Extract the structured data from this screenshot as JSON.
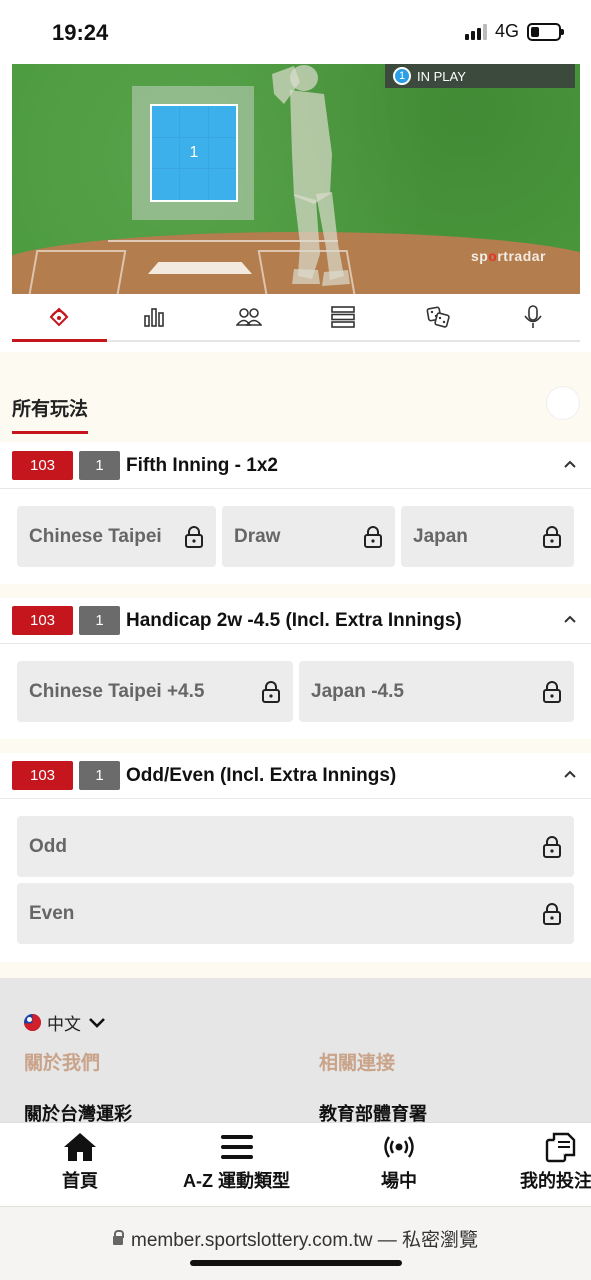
{
  "status": {
    "time": "19:24",
    "network": "4G"
  },
  "field": {
    "in_play": "IN PLAY",
    "in_play_count": "1",
    "zone_label": "1",
    "brand_pre": "sp",
    "brand_dot": "o",
    "brand_post": "rtradar"
  },
  "viz_tabs": [
    {
      "icon": "field-icon",
      "active": true
    },
    {
      "icon": "stats-icon"
    },
    {
      "icon": "lineup-icon"
    },
    {
      "icon": "list-icon"
    },
    {
      "icon": "dice-icon"
    },
    {
      "icon": "mic-icon"
    }
  ],
  "section": {
    "title": "所有玩法"
  },
  "markets": [
    {
      "code": "103",
      "num": "1",
      "title": "Fifth Inning - 1x2",
      "options": [
        "Chinese Taipei",
        "Draw",
        "Japan"
      ]
    },
    {
      "code": "103",
      "num": "1",
      "title": "Handicap 2w -4.5 (Incl. Extra Innings)",
      "options": [
        "Chinese Taipei +4.5",
        "Japan -4.5"
      ]
    },
    {
      "code": "103",
      "num": "1",
      "title": "Odd/Even (Incl. Extra Innings)",
      "options": [
        "Odd",
        "Even"
      ]
    }
  ],
  "footer": {
    "language": "中文",
    "col1_heading": "關於我們",
    "col2_heading": "相關連接",
    "col1_link": "關於台灣運彩",
    "col2_link": "教育部體育署"
  },
  "bottom_nav": [
    {
      "label": "首頁",
      "icon": "home-icon"
    },
    {
      "label": "A-Z 運動類型",
      "icon": "menu-icon"
    },
    {
      "label": "場中",
      "icon": "live-icon"
    },
    {
      "label": "我的投注",
      "icon": "bets-icon"
    }
  ],
  "browser": {
    "url": "member.sportslottery.com.tw — 私密瀏覽"
  },
  "colors": {
    "accent": "#c4161c",
    "field_green": "#4a9a3c",
    "zone_blue": "#3cb0ea"
  }
}
